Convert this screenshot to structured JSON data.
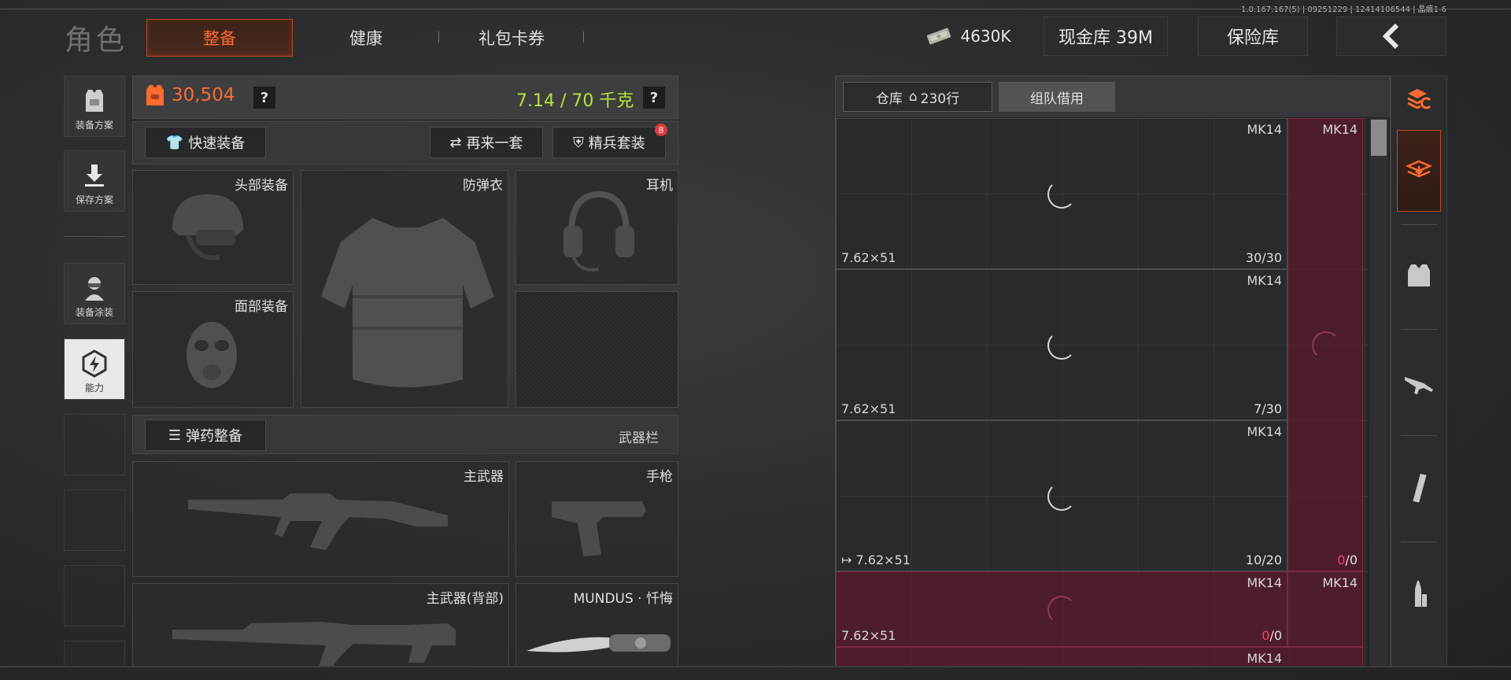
{
  "version": "1.0.167.167(5) | 09251229 | 12414106544 | 晶痕1-6",
  "header": {
    "title": "角色",
    "tabs": [
      {
        "label": "整备",
        "active": true
      },
      {
        "label": "健康",
        "active": false
      },
      {
        "label": "礼包卡券",
        "active": false
      }
    ],
    "money": "4630K",
    "cash_vault": "现金库 39M",
    "insurance": "保险库",
    "back_icon": "chevron-left-icon"
  },
  "sidebar": {
    "items": [
      {
        "label": "装备方案",
        "icon": "vest-icon"
      },
      {
        "label": "保存方案",
        "icon": "download-icon"
      },
      {
        "label": "装备涂装",
        "icon": "soldier-icon"
      },
      {
        "label": "能力",
        "icon": "lightning-hex-icon",
        "active": true
      }
    ]
  },
  "equipment": {
    "armor_value": "30,504",
    "weight": "7.14 / 70 千克",
    "help": "?",
    "quick_equip": "快速装备",
    "again_set": "再来一套",
    "elite_set": "精兵套装",
    "elite_badge": "8",
    "slots": {
      "helmet": "头部装备",
      "vest": "防弹衣",
      "earphone": "耳机",
      "face": "面部装备"
    },
    "ammo_button": "弹药整备",
    "weapon_bar": "武器栏",
    "weapons": {
      "primary": "主武器",
      "pistol": "手枪",
      "primary_back": "主武器(背部)",
      "melee": "MUNDUS · 忏悔"
    }
  },
  "warehouse": {
    "storage_tab": "仓库",
    "rows": "230行",
    "team_tab": "组队借用",
    "items": [
      {
        "name": "MK14",
        "caliber": "7.62×51",
        "count": "30/30",
        "red": false
      },
      {
        "name": "MK14",
        "caliber": "",
        "count": "",
        "red": true
      },
      {
        "name": "MK14",
        "caliber": "7.62×51",
        "count": "7/30",
        "red": false
      },
      {
        "name": "MK14",
        "caliber": "7.62×51",
        "count": "10/20",
        "red": false,
        "equipped": true
      },
      {
        "name": "MK14",
        "caliber": "7.62×51",
        "count_zero": "0",
        "count_rest": "/0",
        "red": true
      },
      {
        "name": "MK14",
        "caliber": "",
        "count": "",
        "red": true
      },
      {
        "name": "MK14",
        "caliber": "",
        "count": "",
        "red": false
      }
    ],
    "red_side_count_zero": "0",
    "red_side_count_rest": "/0"
  },
  "categories": [
    "stack-refresh-icon",
    "layers-download-icon",
    "armor-icon",
    "rifle-icon",
    "magazine-icon",
    "bullet-icon"
  ],
  "colors": {
    "accent": "#ff6a2f",
    "weight": "#b6e23a",
    "danger": "#ff3a6a"
  }
}
